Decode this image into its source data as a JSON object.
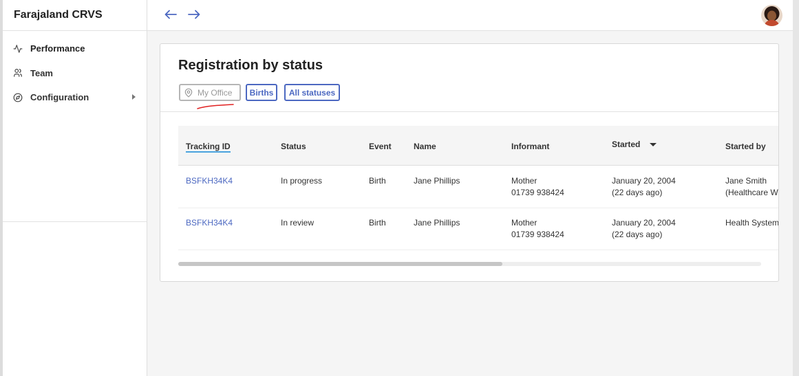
{
  "app": {
    "title": "Farajaland CRVS"
  },
  "sidebar": {
    "items": [
      {
        "label": "Performance",
        "icon": "activity-icon"
      },
      {
        "label": "Team",
        "icon": "users-icon"
      },
      {
        "label": "Configuration",
        "icon": "compass-icon"
      }
    ]
  },
  "card": {
    "title": "Registration by status",
    "filters": {
      "office": "My Office",
      "event": "Births",
      "status": "All statuses"
    }
  },
  "table": {
    "headers": [
      "Tracking ID",
      "Status",
      "Event",
      "Name",
      "Informant",
      "Started",
      "Started by"
    ],
    "rows": [
      {
        "tracking_id": "BSFKH34K4",
        "status": "In progress",
        "event": "Birth",
        "name": "Jane Phillips",
        "informant": "Mother",
        "informant_phone": "01739 938424",
        "started": "January 20, 2004",
        "started_ago": "(22 days ago)",
        "started_by": "Jane Smith",
        "started_by_role": "(Healthcare W"
      },
      {
        "tracking_id": "BSFKH34K4",
        "status": "In review",
        "event": "Birth",
        "name": "Jane Phillips",
        "informant": "Mother",
        "informant_phone": "01739 938424",
        "started": "January 20, 2004",
        "started_ago": "(22 days ago)",
        "started_by": "Health System",
        "started_by_role": ""
      }
    ],
    "scroll_fraction": 0.556
  },
  "colors": {
    "accent": "#4c68c1",
    "underline": "#4aa3df",
    "annotation": "#e02020"
  }
}
